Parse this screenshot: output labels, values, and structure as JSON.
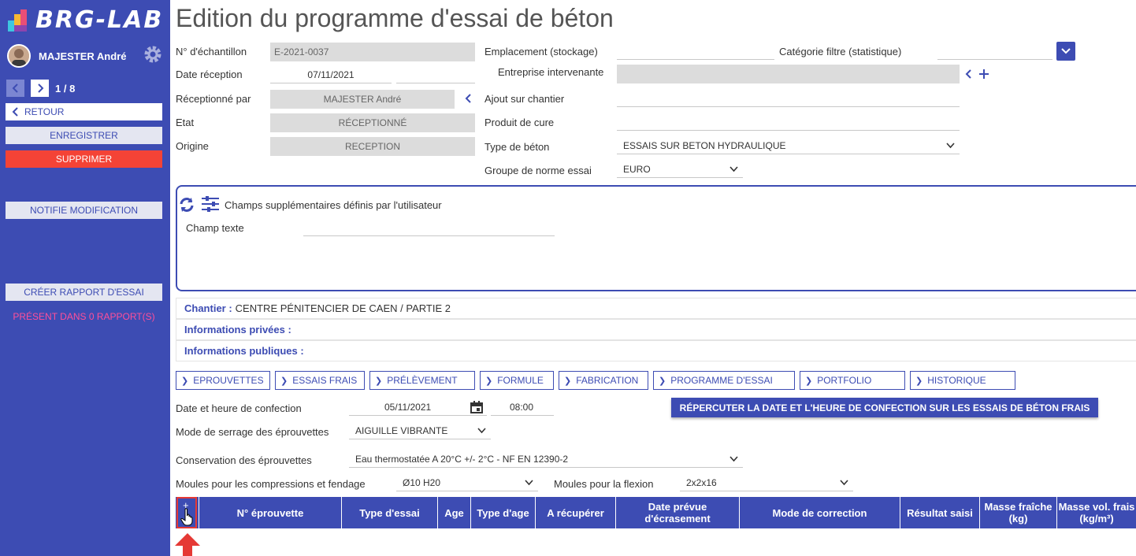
{
  "app": {
    "logo_text": "BRG-LAB",
    "title": "Edition du programme d'essai de béton"
  },
  "sidebar": {
    "user_name": "MAJESTER André",
    "pager": "1 / 8",
    "retour": "RETOUR",
    "enregistrer": "ENREGISTRER",
    "supprimer": "SUPPRIMER",
    "notifie": "NOTIFIE MODIFICATION",
    "creer_rapport": "CRÉER RAPPORT D'ESSAI",
    "present": "PRÉSENT DANS 0 RAPPORT(S)"
  },
  "form": {
    "echantillon_label": "N° d'échantillon",
    "echantillon_value": "E-2021-0037",
    "date_reception_label": "Date réception",
    "date_reception_value": "07/11/2021",
    "receptionne_label": "Réceptionné par",
    "receptionne_value": "MAJESTER André",
    "etat_label": "Etat",
    "etat_value": "RÉCEPTIONNÉ",
    "origine_label": "Origine",
    "origine_value": "RECEPTION",
    "emplacement_label": "Emplacement (stockage)",
    "categorie_label": "Catégorie filtre (statistique)",
    "entreprise_label": "Entreprise intervenante",
    "ajout_label": "Ajout sur chantier",
    "cure_label": "Produit de cure",
    "type_beton_label": "Type de béton",
    "type_beton_value": "ESSAIS SUR BETON HYDRAULIQUE",
    "groupe_label": "Groupe de norme essai",
    "groupe_value": "EURO"
  },
  "extra": {
    "title": "Champs supplémentaires définis par l'utilisateur",
    "champ_texte_label": "Champ texte"
  },
  "info": {
    "chantier_key": "Chantier :",
    "chantier_value": "CENTRE PÉNITENCIER DE CAEN / PARTIE 2",
    "privees_key": "Informations privées :",
    "publiques_key": "Informations publiques :"
  },
  "tabs": [
    "EPROUVETTES",
    "ESSAIS FRAIS",
    "PRÉLÈVEMENT",
    "FORMULE",
    "FABRICATION",
    "PROGRAMME D'ESSAI",
    "PORTFOLIO",
    "HISTORIQUE"
  ],
  "confection": {
    "date_label": "Date et heure de confection",
    "date_value": "05/11/2021",
    "time_value": "08:00",
    "repercuter": "RÉPERCUTER LA DATE ET L'HEURE DE CONFECTION SUR LES ESSAIS DE BÉTON FRAIS",
    "serrage_label": "Mode de serrage des éprouvettes",
    "serrage_value": "AIGUILLE VIBRANTE",
    "conservation_label": "Conservation des éprouvettes",
    "conservation_value": "Eau thermostatée A 20°C +/- 2°C - NF EN 12390-2",
    "moules_comp_label": "Moules pour les compressions et fendage",
    "moules_comp_value": "Ø10 H20",
    "moules_flex_label": "Moules pour la flexion",
    "moules_flex_value": "2x2x16"
  },
  "table": {
    "add": "+",
    "columns": [
      "N° éprouvette",
      "Type d'essai",
      "Age",
      "Type d'age",
      "A récupérer",
      "Date prévue d'écrasement",
      "Mode de correction",
      "Résultat saisi",
      "Masse fraîche (kg)",
      "Masse vol. frais (kg/m³)"
    ]
  },
  "colors": {
    "primary": "#3d4cb3",
    "danger": "#f44336",
    "present": "#ff4f9a"
  }
}
